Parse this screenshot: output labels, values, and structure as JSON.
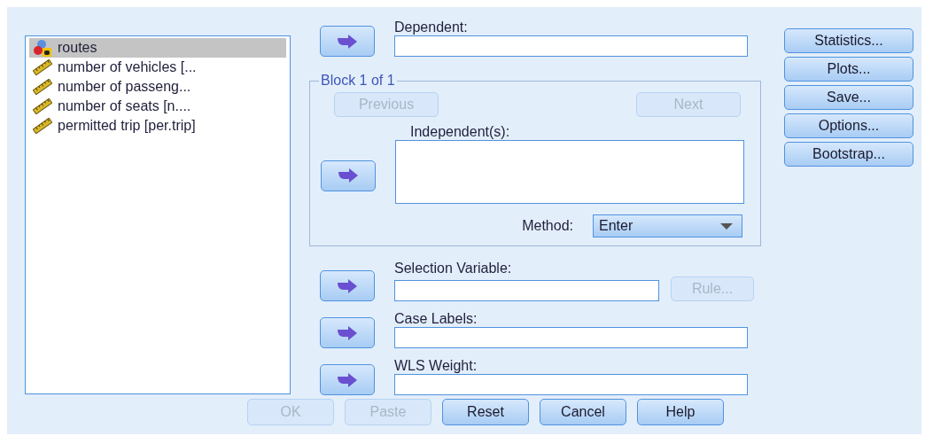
{
  "variables": [
    {
      "name": "routes",
      "kind": "nominal",
      "selected": true
    },
    {
      "name": "number of vehicles [...",
      "kind": "scale",
      "selected": false
    },
    {
      "name": "number of passeng...",
      "kind": "scale",
      "selected": false
    },
    {
      "name": "number of seats [n....",
      "kind": "scale",
      "selected": false
    },
    {
      "name": "permitted trip [per.trip]",
      "kind": "scale",
      "selected": false
    }
  ],
  "dependent": {
    "label": "Dependent:"
  },
  "block": {
    "title": "Block 1 of 1",
    "previous": {
      "label": "Previous",
      "disabled": true
    },
    "next": {
      "label": "Next",
      "disabled": true
    },
    "independents": {
      "label": "Independent(s):"
    },
    "method": {
      "label": "Method:",
      "value": "Enter"
    }
  },
  "selection_variable": {
    "label": "Selection Variable:",
    "rule": {
      "label": "Rule...",
      "disabled": true
    }
  },
  "case_labels": {
    "label": "Case Labels:"
  },
  "wls_weight": {
    "label": "WLS Weight:"
  },
  "side_buttons": [
    {
      "label": "Statistics...",
      "disabled": false
    },
    {
      "label": "Plots...",
      "disabled": false
    },
    {
      "label": "Save...",
      "disabled": false
    },
    {
      "label": "Options...",
      "disabled": false
    },
    {
      "label": "Bootstrap...",
      "disabled": false
    }
  ],
  "buttons": [
    {
      "label": "OK",
      "disabled": true
    },
    {
      "label": "Paste",
      "disabled": true
    },
    {
      "label": "Reset",
      "disabled": false
    },
    {
      "label": "Cancel",
      "disabled": false
    },
    {
      "label": "Help",
      "disabled": false
    }
  ]
}
